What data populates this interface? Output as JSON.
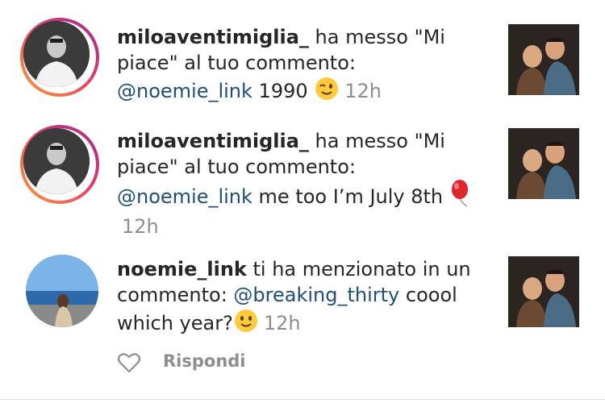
{
  "notifications": [
    {
      "username": "miloaventimiglia_",
      "action": " ha messo \"Mi piace\" al tuo commento: ",
      "mention": "@noemie_link",
      "comment": " 1990 ",
      "emoji": "winking-face-emoji",
      "time": "12h"
    },
    {
      "username": "miloaventimiglia_",
      "action": " ha messo \"Mi piace\" al tuo commento: ",
      "mention": "@noemie_link",
      "comment": " me too I’m July 8th ",
      "emoji": "balloon-emoji",
      "time": "12h"
    },
    {
      "username": "noemie_link",
      "action": " ti ha menzionato in un commento: ",
      "mention": "@breaking_thirty",
      "comment": " coool which year?",
      "emoji": "smiling-face-emoji",
      "time": "12h"
    }
  ],
  "reply": {
    "label": "Rispondi",
    "icon": "heart-icon"
  },
  "colors": {
    "mention": "#1f4e79",
    "time": "#8e8e8e",
    "story_ring": "#ee4f5f"
  }
}
